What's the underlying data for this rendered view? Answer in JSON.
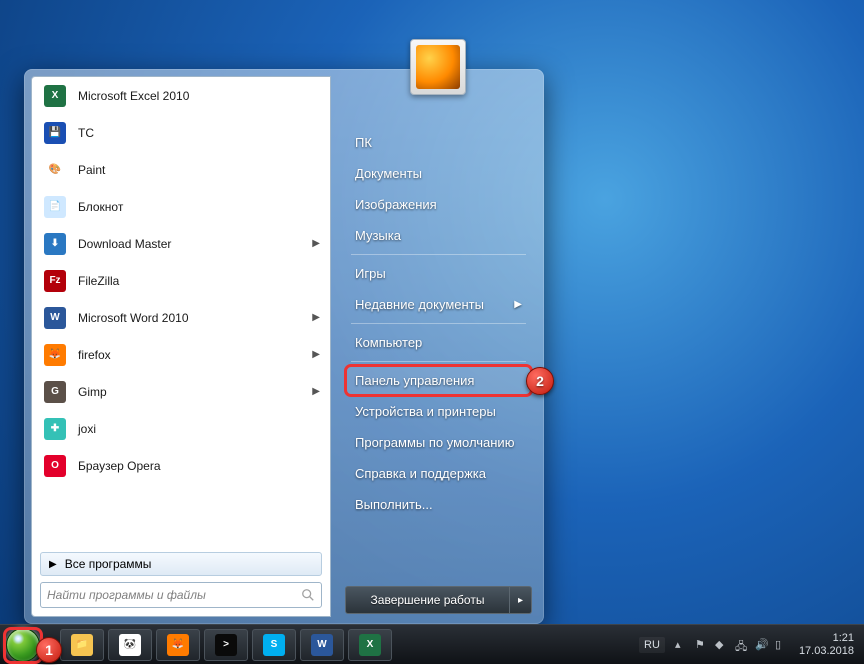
{
  "start_menu": {
    "programs": [
      {
        "label": "Microsoft Excel 2010",
        "icon": "excel-icon",
        "has_submenu": false,
        "icon_bg": "#1f7244",
        "icon_text": "X"
      },
      {
        "label": "TC",
        "icon": "tc-icon",
        "has_submenu": false,
        "icon_bg": "#1a4fb3",
        "icon_text": "💾"
      },
      {
        "label": "Paint",
        "icon": "paint-icon",
        "has_submenu": false,
        "icon_bg": "#ffffff",
        "icon_text": "🎨"
      },
      {
        "label": "Блокнот",
        "icon": "notepad-icon",
        "has_submenu": false,
        "icon_bg": "#cfe8ff",
        "icon_text": "📄"
      },
      {
        "label": "Download Master",
        "icon": "download-master-icon",
        "has_submenu": true,
        "icon_bg": "#2a78c2",
        "icon_text": "⬇"
      },
      {
        "label": "FileZilla",
        "icon": "filezilla-icon",
        "has_submenu": false,
        "icon_bg": "#b3000a",
        "icon_text": "Fz"
      },
      {
        "label": "Microsoft Word 2010",
        "icon": "word-icon",
        "has_submenu": true,
        "icon_bg": "#2b579a",
        "icon_text": "W"
      },
      {
        "label": "firefox",
        "icon": "firefox-icon",
        "has_submenu": true,
        "icon_bg": "#ff7b00",
        "icon_text": "🦊"
      },
      {
        "label": "Gimp",
        "icon": "gimp-icon",
        "has_submenu": true,
        "icon_bg": "#5b5048",
        "icon_text": "G"
      },
      {
        "label": "joxi",
        "icon": "joxi-icon",
        "has_submenu": false,
        "icon_bg": "#34c1b6",
        "icon_text": "✚"
      },
      {
        "label": "Браузер Opera",
        "icon": "opera-icon",
        "has_submenu": false,
        "icon_bg": "#e3002b",
        "icon_text": "O"
      }
    ],
    "all_programs_label": "Все программы",
    "search_placeholder": "Найти программы и файлы",
    "right_items": [
      {
        "label": "ПК",
        "kind": "item"
      },
      {
        "label": "Документы",
        "kind": "item"
      },
      {
        "label": "Изображения",
        "kind": "item"
      },
      {
        "label": "Музыка",
        "kind": "item"
      },
      {
        "kind": "sep"
      },
      {
        "label": "Игры",
        "kind": "item"
      },
      {
        "label": "Недавние документы",
        "kind": "item",
        "has_submenu": true
      },
      {
        "kind": "sep"
      },
      {
        "label": "Компьютер",
        "kind": "item"
      },
      {
        "kind": "sep"
      },
      {
        "label": "Панель управления",
        "kind": "item",
        "highlight": true
      },
      {
        "label": "Устройства и принтеры",
        "kind": "item"
      },
      {
        "label": "Программы по умолчанию",
        "kind": "item"
      },
      {
        "label": "Справка и поддержка",
        "kind": "item"
      },
      {
        "label": "Выполнить...",
        "kind": "item"
      }
    ],
    "shutdown_label": "Завершение работы"
  },
  "taskbar": {
    "apps": [
      {
        "name": "explorer-icon",
        "bg": "#f6c451",
        "text": "📁"
      },
      {
        "name": "panda-icon",
        "bg": "#ffffff",
        "text": "🐼"
      },
      {
        "name": "firefox-icon",
        "bg": "#ff7b00",
        "text": "🦊"
      },
      {
        "name": "cmd-icon",
        "bg": "#0a0a0a",
        "text": ">"
      },
      {
        "name": "skype-icon",
        "bg": "#00aff0",
        "text": "S"
      },
      {
        "name": "word-icon",
        "bg": "#2b579a",
        "text": "W"
      },
      {
        "name": "excel-icon",
        "bg": "#1f7244",
        "text": "X"
      }
    ],
    "lang": "RU",
    "time": "1:21",
    "date": "17.03.2018"
  },
  "callouts": {
    "one": "1",
    "two": "2"
  }
}
